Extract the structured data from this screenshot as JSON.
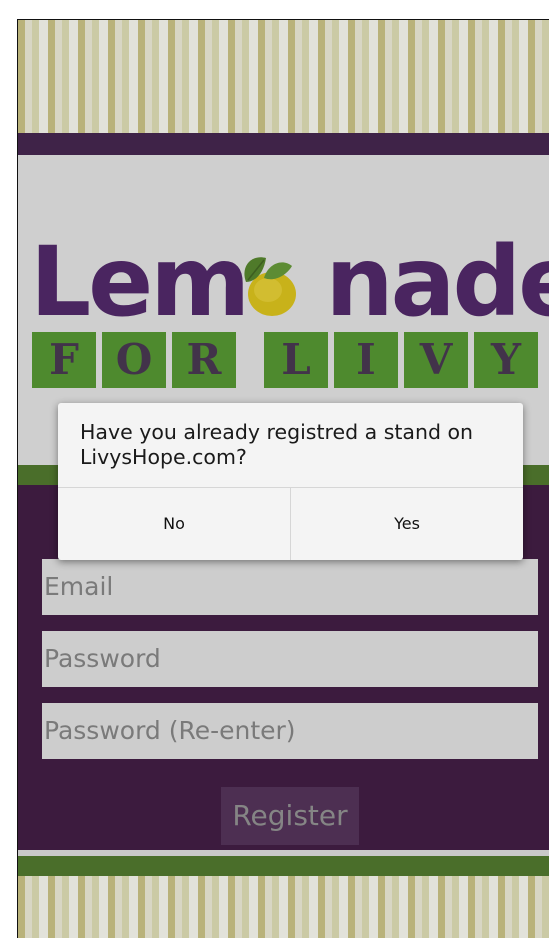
{
  "logo": {
    "word_left": "Lem",
    "word_right": "nade",
    "for_livy_letters": [
      "F",
      "O",
      "R",
      "L",
      "I",
      "V",
      "Y"
    ]
  },
  "form": {
    "email_placeholder": "Email",
    "password_placeholder": "Password",
    "password_reenter_placeholder": "Password (Re-enter)",
    "register_label": "Register"
  },
  "dialog": {
    "message": "Have you already registred a stand on LivysHope.com?",
    "no_label": "No",
    "yes_label": "Yes"
  },
  "colors": {
    "purple": "#4a2560",
    "green": "#4e8a2e",
    "form_background": "#3c1b3e"
  }
}
